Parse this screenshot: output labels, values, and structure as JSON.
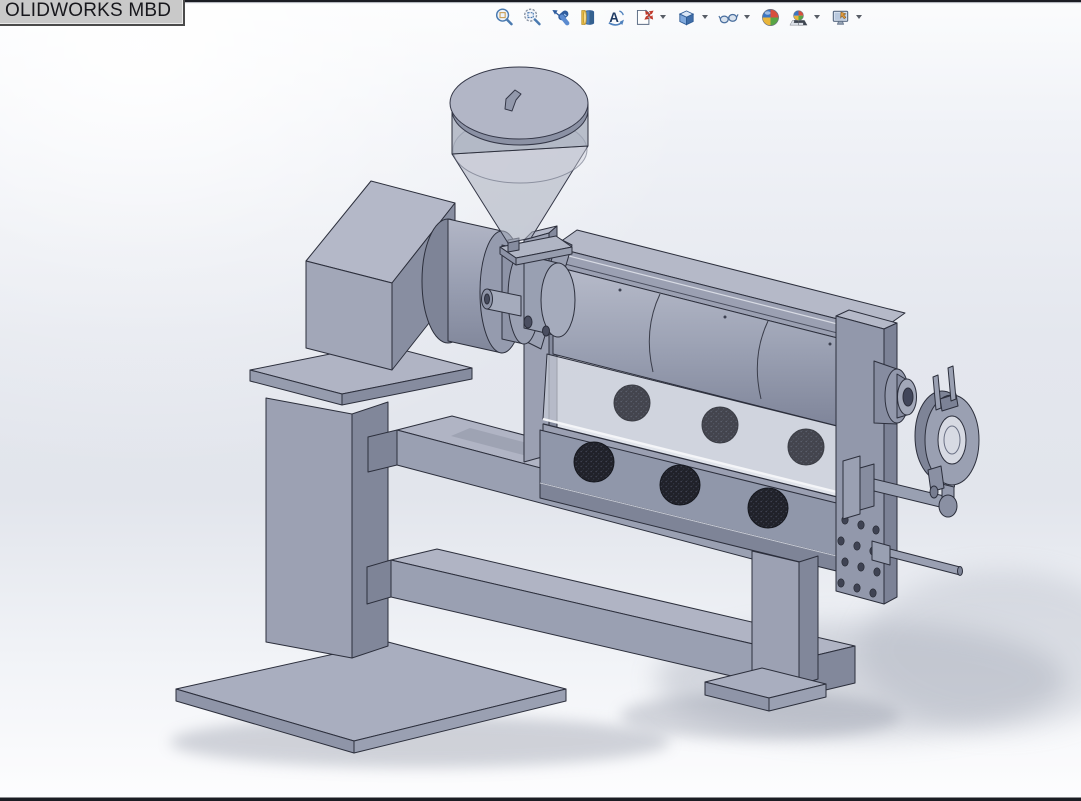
{
  "window": {
    "tab_label": "OLIDWORKS MBD"
  },
  "toolbar": {
    "buttons": [
      {
        "id": "zoom-to-fit",
        "icon": "zoom-to-fit-icon",
        "has_dropdown": false
      },
      {
        "id": "zoom-to-area",
        "icon": "zoom-to-area-icon",
        "has_dropdown": false
      },
      {
        "id": "previous-view",
        "icon": "previous-view-icon",
        "has_dropdown": false
      },
      {
        "id": "section-view",
        "icon": "section-view-icon",
        "has_dropdown": false
      },
      {
        "id": "3d-drawing-view",
        "icon": "3d-drawing-view-icon",
        "has_dropdown": false
      },
      {
        "id": "capture-3d-view",
        "icon": "capture-3d-view-icon",
        "has_dropdown": true
      },
      {
        "id": "display-style",
        "icon": "display-style-cube-icon",
        "has_dropdown": true
      },
      {
        "id": "hide-show-items",
        "icon": "eyeglasses-icon",
        "has_dropdown": true
      },
      {
        "id": "edit-appearance",
        "icon": "appearance-sphere-icon",
        "has_dropdown": false
      },
      {
        "id": "apply-scene",
        "icon": "apply-scene-icon",
        "has_dropdown": true
      },
      {
        "id": "view-settings",
        "icon": "view-settings-icon",
        "has_dropdown": true
      }
    ]
  },
  "viewport": {
    "model_parts": [
      "hopper",
      "hopper-lid",
      "hopper-handle",
      "feed-throat",
      "drive-coupling",
      "gearbox-housing",
      "stand-column",
      "base-plate",
      "upper-shelf",
      "lower-beam",
      "barrel-housing",
      "barrel-cylinder",
      "vent-holes",
      "sight-window",
      "die-end-plate",
      "bearing-hub",
      "clamp-ring",
      "clamp-arm",
      "support-leg",
      "support-foot"
    ],
    "colors": {
      "model_top": "#b5b9c8",
      "model_front": "#a2a7b8",
      "model_side": "#8a90a3",
      "model_dark": "#7c8296",
      "edge": "#2c2f3c",
      "glass": "rgba(201,205,216,0.72)",
      "vent_dark": "#202129",
      "background_mid": "#e2e5ec",
      "tab_background": "#c9c9c9",
      "tab_border": "#4a4a4a",
      "shadow": "#9399a8"
    }
  }
}
